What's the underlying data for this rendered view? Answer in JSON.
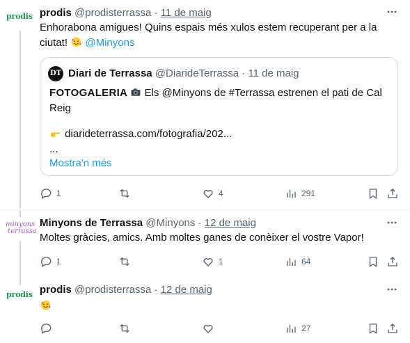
{
  "tweets": [
    {
      "avatar": "prodis",
      "name": "prodis",
      "handle": "@prodisterrassa",
      "sep": "·",
      "date": "11 de maig",
      "text_line1": "Enhorabona amigues! Quins espais més xulos estem recuperant per a la",
      "text_line2": "ciutat!",
      "mention": "@Minyons",
      "quote": {
        "avatar": "DT",
        "name": "Diari de Terrassa",
        "handle": "@DiarideTerrassa",
        "sep": "·",
        "date": "11 de maig",
        "bold": "FOTOGALERIA",
        "text1": " Els @Minyons  de #Terrassa estrenen el pati de Cal",
        "text2": "Reig",
        "link": "diarideterrassa.com/fotografia/202...",
        "ellipsis": "...",
        "show_more": "Mostra'n més"
      },
      "replies": "1",
      "retweets": "",
      "likes": "4",
      "views": "291"
    },
    {
      "avatar": "minyons",
      "name": "Minyons de Terrassa",
      "handle": "@Minyons",
      "sep": "·",
      "date": "12 de maig",
      "text_line1": "Moltes gràcies, amics. Amb moltes ganes de conèixer el vostre Vapor!",
      "replies": "1",
      "retweets": "",
      "likes": "1",
      "views": "64"
    },
    {
      "avatar": "prodis",
      "name": "prodis",
      "handle": "@prodisterrassa",
      "sep": "·",
      "date": "12 de maig",
      "replies": "",
      "retweets": "",
      "likes": "",
      "views": "27"
    }
  ],
  "icons": [
    "reply-icon",
    "retweet-icon",
    "like-icon",
    "views-icon",
    "bookmark-icon",
    "share-icon",
    "more-icon",
    "smiling-face-with-hearts-emoji",
    "camera-emoji",
    "pointing-hand-emoji"
  ],
  "colors": {
    "accent": "#1d9bf0",
    "muted": "#536471",
    "border": "#cfd9de",
    "prodis_green": "#1e9a5a"
  }
}
